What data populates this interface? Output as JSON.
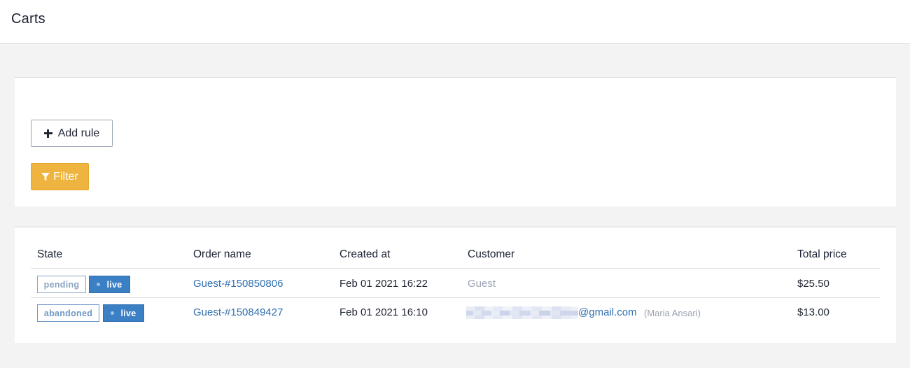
{
  "header": {
    "title": "Carts"
  },
  "filters": {
    "add_rule_label": "Add rule",
    "filter_label": "Filter"
  },
  "table": {
    "columns": [
      "State",
      "Order name",
      "Created at",
      "Customer",
      "Total price"
    ],
    "rows": [
      {
        "state": "pending",
        "mode": "live",
        "order_name": "Guest-#150850806",
        "created_at": "Feb 01 2021 16:22",
        "customer_email": "",
        "customer_name": "Guest",
        "total_price": "$25.50"
      },
      {
        "state": "abandoned",
        "mode": "live",
        "order_name": "Guest-#150849427",
        "created_at": "Feb 01 2021 16:10",
        "customer_email": "@gmail.com",
        "customer_name": "(Maria Ansari)",
        "total_price": "$13.00"
      }
    ]
  },
  "colors": {
    "filter_button": "#efb43f",
    "live_badge": "#3b7fc4",
    "link": "#2f6fb0"
  }
}
